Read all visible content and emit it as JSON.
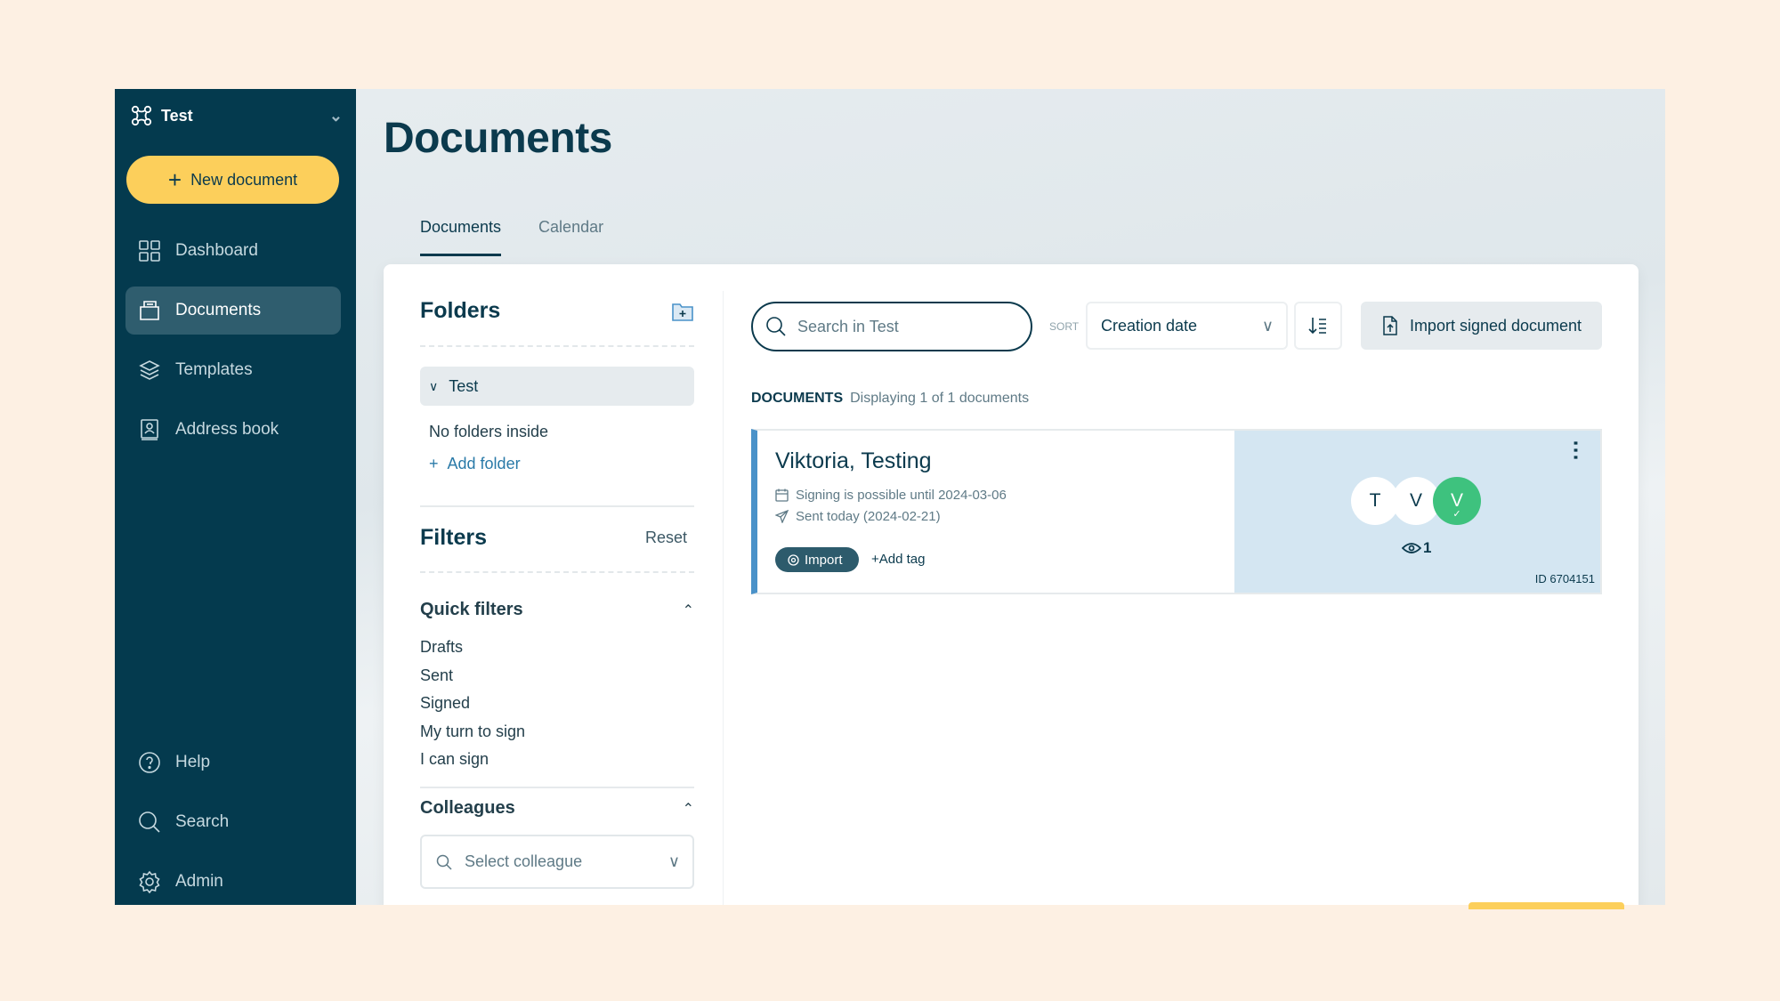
{
  "sidebar": {
    "org_name": "Test",
    "new_document": "New document",
    "nav": [
      {
        "label": "Dashboard",
        "icon": "grid-icon"
      },
      {
        "label": "Documents",
        "icon": "folder-icon",
        "active": true
      },
      {
        "label": "Templates",
        "icon": "layers-icon"
      },
      {
        "label": "Address book",
        "icon": "contact-book-icon"
      }
    ],
    "bottom": [
      {
        "label": "Help",
        "icon": "help-icon"
      },
      {
        "label": "Search",
        "icon": "search-icon"
      },
      {
        "label": "Admin",
        "icon": "gear-icon"
      }
    ]
  },
  "header": {
    "title": "Documents",
    "tabs": [
      {
        "label": "Documents",
        "active": true
      },
      {
        "label": "Calendar"
      }
    ]
  },
  "folders": {
    "title": "Folders",
    "root": "Test",
    "empty": "No folders inside",
    "add": "Add folder"
  },
  "filters": {
    "title": "Filters",
    "reset": "Reset",
    "quick_title": "Quick filters",
    "quick": [
      "Drafts",
      "Sent",
      "Signed",
      "My turn to sign",
      "I can sign"
    ],
    "colleagues_title": "Colleagues",
    "colleague_placeholder": "Select colleague"
  },
  "toolbar": {
    "search_placeholder": "Search in Test",
    "sort_label": "SORT",
    "sort_value": "Creation date",
    "import_label": "Import signed document"
  },
  "list": {
    "heading": "DOCUMENTS",
    "count": "Displaying 1 of 1 documents",
    "documents": [
      {
        "title": "Viktoria, Testing",
        "deadline": "Signing is possible until 2024-03-06",
        "sent": "Sent today (2024-02-21)",
        "tag": "Import",
        "add_tag": "+Add tag",
        "signers": [
          {
            "initial": "T",
            "signed": false
          },
          {
            "initial": "V",
            "signed": false
          },
          {
            "initial": "V",
            "signed": true
          }
        ],
        "views": "1",
        "id": "ID 6704151"
      }
    ]
  },
  "colors": {
    "sidebar": "#043a4e",
    "accent_yellow": "#fccf5b",
    "primary": "#0b3a4d",
    "signed_green": "#3ec27e",
    "doc_accent": "#4a92c9",
    "link": "#2a7aa8"
  }
}
